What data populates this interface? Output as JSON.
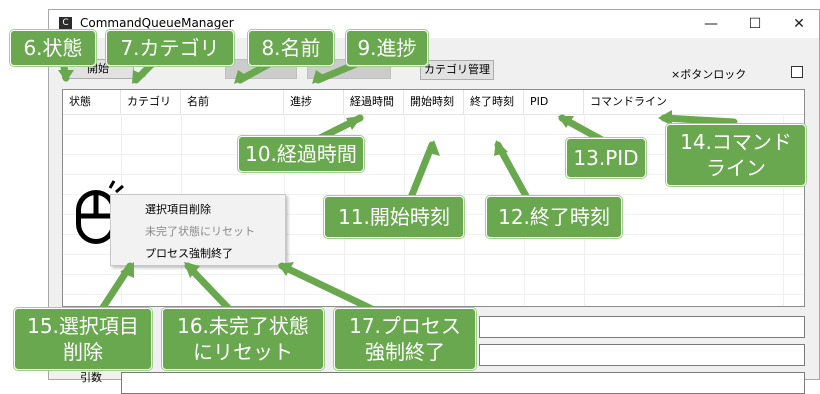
{
  "window": {
    "title": "CommandQueueManager",
    "icon": "app-icon",
    "icon_glyph": "C",
    "controls": [
      "—",
      "☐",
      "✕"
    ]
  },
  "toolbar": {
    "open_label": "開始",
    "category_manage_label": "カテゴリ管理",
    "lock_label": "×ボタンロック"
  },
  "list": {
    "columns": [
      "状態",
      "カテゴリ",
      "名前",
      "進捗",
      "経過時間",
      "開始時刻",
      "終了時刻",
      "PID",
      "コマンドライン"
    ]
  },
  "context_menu": {
    "items": [
      {
        "label": "選択項目削除",
        "enabled": true
      },
      {
        "label": "未完了状態にリセット",
        "enabled": false
      },
      {
        "label": "プロセス強制終了",
        "enabled": true
      }
    ]
  },
  "bottom": {
    "args_label": "引数"
  },
  "callouts": [
    {
      "id": "6",
      "text": "6.状態"
    },
    {
      "id": "7",
      "text": "7.カテゴリ"
    },
    {
      "id": "8",
      "text": "8.名前"
    },
    {
      "id": "9",
      "text": "9.進捗"
    },
    {
      "id": "10",
      "text": "10.経過時間"
    },
    {
      "id": "11",
      "text": "11.開始時刻"
    },
    {
      "id": "12",
      "text": "12.終了時刻"
    },
    {
      "id": "13",
      "text": "13.PID"
    },
    {
      "id": "14",
      "text": "14.コマンド\nライン"
    },
    {
      "id": "15",
      "text": "15.選択項目\n削除"
    },
    {
      "id": "16",
      "text": "16.未完了状態\nにリセット"
    },
    {
      "id": "17",
      "text": "17.プロセス\n強制終了"
    }
  ],
  "colors": {
    "callout_bg": "#6aa84f",
    "window_bg": "#f0f0f0"
  }
}
